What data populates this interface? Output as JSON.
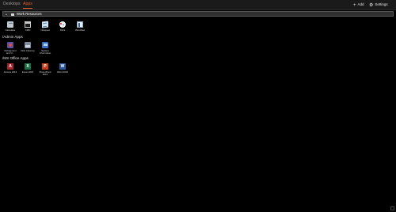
{
  "tabs": [
    {
      "label": "Desktops",
      "active": false
    },
    {
      "label": "Apps",
      "active": true
    }
  ],
  "toolbar": {
    "add_label": "Add",
    "settings_label": "Settings"
  },
  "group": {
    "title": "Work Resources"
  },
  "sections": {
    "windows_apps": [
      {
        "label": "Calculator",
        "icon": "calculator-icon"
      },
      {
        "label": "CMD",
        "icon": "command-prompt-icon"
      },
      {
        "label": "Notepad",
        "icon": "notepad-icon"
      },
      {
        "label": "Paint",
        "icon": "paint-icon"
      },
      {
        "label": "WordPad",
        "icon": "wordpad-icon"
      }
    ],
    "admin": {
      "title": "/Admin Apps",
      "apps": [
        {
          "label": "Defragment and O...",
          "icon": "defragment-icon"
        },
        {
          "label": "Disk Cleanup",
          "icon": "disk-cleanup-icon"
        },
        {
          "label": "System Information",
          "icon": "system-information-icon"
        }
      ]
    },
    "office": {
      "title": "/MS Office Apps",
      "apps": [
        {
          "label": "Access 2016",
          "icon": "access-icon",
          "letter": "A"
        },
        {
          "label": "Excel 2016",
          "icon": "excel-icon",
          "letter": "X"
        },
        {
          "label": "PowerPoint 2016",
          "icon": "powerpoint-icon",
          "letter": "P"
        },
        {
          "label": "Word 2016",
          "icon": "word-icon",
          "letter": "W"
        }
      ]
    }
  },
  "colors": {
    "accent": "#e1612a",
    "background": "#000000",
    "topbar": "#1a1a1a",
    "group_bar": "#2f2f2f"
  }
}
